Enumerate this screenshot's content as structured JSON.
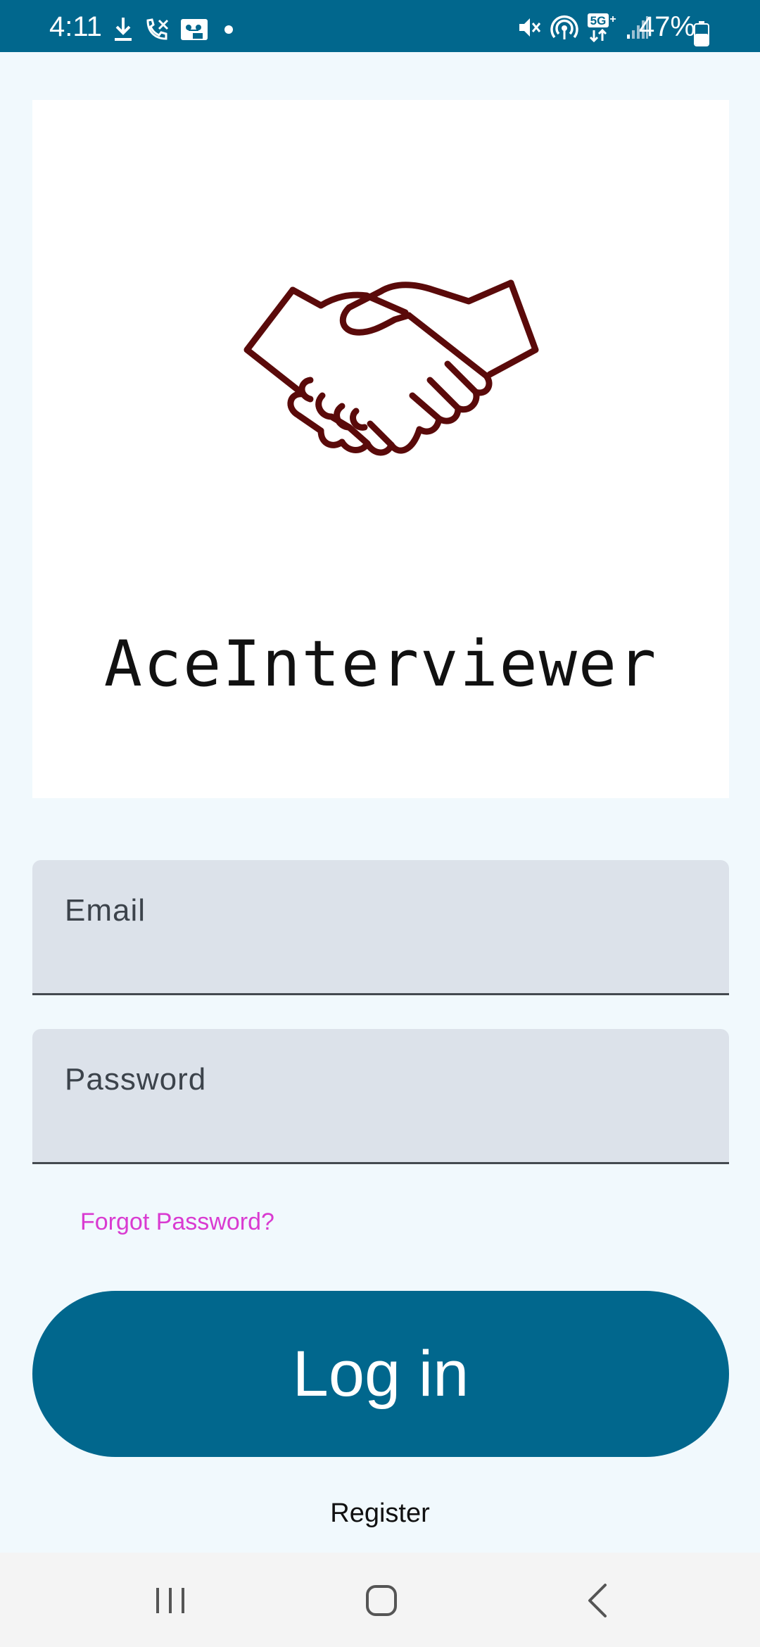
{
  "status_bar": {
    "time": "4:11",
    "battery": "47%",
    "left_icons": [
      "download-icon",
      "missed-call-icon",
      "voicemail-icon",
      "dot-icon"
    ],
    "right_icons": [
      "mute-icon",
      "hotspot-icon",
      "5g-icon",
      "signal-icon",
      "battery-icon"
    ]
  },
  "logo": {
    "icon": "handshake-icon",
    "app_name": "AceInterviewer"
  },
  "form": {
    "email_placeholder": "Email",
    "password_placeholder": "Password",
    "forgot_password": "Forgot Password?",
    "login_label": "Log in",
    "register_label": "Register"
  },
  "colors": {
    "primary": "#01678d",
    "background": "#f1f9fd",
    "field_background": "#dce2ea",
    "link_pink": "#d93bd1",
    "logo_maroon": "#5a0a0a"
  },
  "nav_bar": {
    "buttons": [
      "recent-apps-icon",
      "home-icon",
      "back-icon"
    ]
  }
}
